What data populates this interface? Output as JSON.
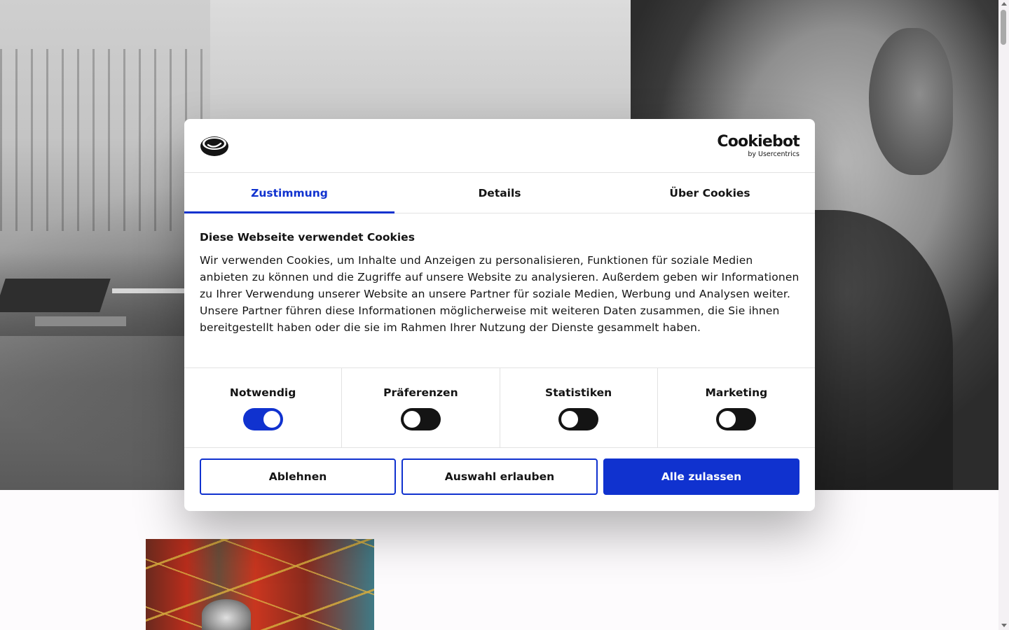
{
  "dialog": {
    "brand": {
      "name": "Cookiebot",
      "subtitle": "by Usercentrics"
    },
    "tabs": [
      {
        "label": "Zustimmung",
        "active": true
      },
      {
        "label": "Details",
        "active": false
      },
      {
        "label": "Über Cookies",
        "active": false
      }
    ],
    "title": "Diese Webseite verwendet Cookies",
    "description": "Wir verwenden Cookies, um Inhalte und Anzeigen zu personalisieren, Funktionen für soziale Medien anbieten zu können und die Zugriffe auf unsere Website zu analysieren. Außerdem geben wir Informationen zu Ihrer Verwendung unserer Website an unsere Partner für soziale Medien, Werbung und Analysen weiter. Unsere Partner führen diese Informationen möglicherweise mit weiteren Daten zusammen, die Sie ihnen bereitgestellt haben oder die sie im Rahmen Ihrer Nutzung der Dienste gesammelt haben.",
    "categories": [
      {
        "label": "Notwendig",
        "enabled": true
      },
      {
        "label": "Präferenzen",
        "enabled": false
      },
      {
        "label": "Statistiken",
        "enabled": false
      },
      {
        "label": "Marketing",
        "enabled": false
      }
    ],
    "buttons": {
      "decline": "Ablehnen",
      "allow_selection": "Auswahl erlauben",
      "allow_all": "Alle zulassen"
    }
  },
  "colors": {
    "accent": "#1032cf",
    "toggle_off": "#141414",
    "dialog_background": "#ffffff",
    "page_background": "#fdfbfd"
  },
  "icons": {
    "brand_logo": "cookie-logo-icon"
  }
}
